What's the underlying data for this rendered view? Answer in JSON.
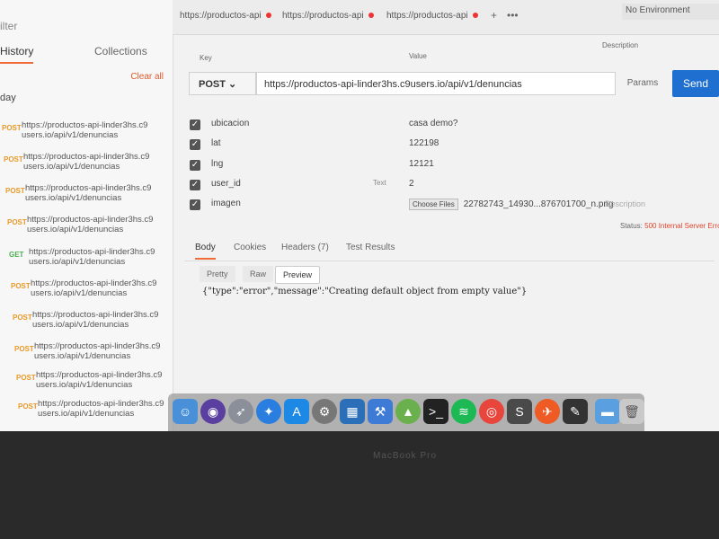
{
  "sidebar": {
    "search_placeholder": "ilter",
    "tabs": [
      "History",
      "Collections"
    ],
    "clear_all": "Clear all",
    "group_label": "day",
    "items": [
      {
        "method": "POST",
        "url": "https://productos-api-linder3hs.c9 users.io/api/v1/denuncias"
      },
      {
        "method": "POST",
        "url": "https://productos-api-linder3hs.c9 users.io/api/v1/denuncias"
      },
      {
        "method": "POST",
        "url": "https://productos-api-linder3hs.c9 users.io/api/v1/denuncias"
      },
      {
        "method": "POST",
        "url": "https://productos-api-linder3hs.c9 users.io/api/v1/denuncias"
      },
      {
        "method": "GET",
        "url": "https://productos-api-linder3hs.c9 users.io/api/v1/denuncias"
      },
      {
        "method": "POST",
        "url": "https://productos-api-linder3hs.c9 users.io/api/v1/denuncias"
      },
      {
        "method": "POST",
        "url": "https://productos-api-linder3hs.c9 users.io/api/v1/denuncias"
      },
      {
        "method": "POST",
        "url": "https://productos-api-linder3hs.c9 users.io/api/v1/denuncias"
      },
      {
        "method": "POST",
        "url": "https://productos-api-linder3hs.c9 users.io/api/v1/denuncias"
      },
      {
        "method": "POST",
        "url": "https://productos-api-linder3hs.c9 users.io/api/v1/denuncias"
      }
    ]
  },
  "tabs": [
    "https://productos-api",
    "https://productos-api",
    "https://productos-api"
  ],
  "tab_add": "+",
  "tab_more": "•••",
  "environment": "No Environment",
  "request": {
    "method": "POST",
    "url": "https://productos-api-linder3hs.c9users.io/api/v1/denuncias",
    "params_label": "Params",
    "send_label": "Send"
  },
  "table_headers": {
    "key": "Key",
    "value": "Value",
    "description": "Description"
  },
  "params": [
    {
      "key": "ubicacion",
      "value": "casa demo?"
    },
    {
      "key": "lat",
      "value": "122198"
    },
    {
      "key": "lng",
      "value": "12121"
    },
    {
      "key": "user_id",
      "value": "2",
      "type": "Text"
    },
    {
      "key": "imagen",
      "value": "22782743_14930...876701700_n.png",
      "button": "Choose Files"
    }
  ],
  "description_placeholder": "Description",
  "status": {
    "label": "Status:",
    "code": "500 Internal Server Erro"
  },
  "response_tabs": [
    "Body",
    "Cookies",
    "Headers (7)",
    "Test Results"
  ],
  "view_modes": [
    "Pretty",
    "Raw",
    "Preview"
  ],
  "response_body": "{\"type\":\"error\",\"message\":\"Creating default object from empty value\"}",
  "dock": [
    "finder-icon",
    "siri-icon",
    "launchpad-icon",
    "safari-icon",
    "app-store-icon",
    "system-preferences-icon",
    "tower-icon",
    "xcode-icon",
    "android-studio-icon",
    "terminal-icon",
    "spotify-icon",
    "chrome-icon",
    "sublime-icon",
    "postman-icon",
    "sketch-icon",
    "folder-icon",
    "trash-icon"
  ],
  "bezel_text": "MacBook Pro"
}
